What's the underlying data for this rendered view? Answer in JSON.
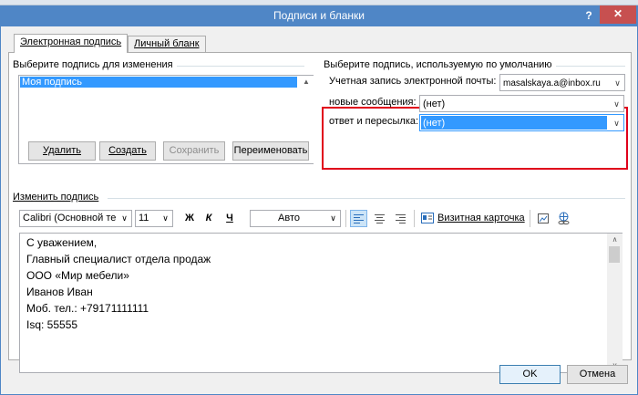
{
  "window": {
    "title": "Подписи и бланки",
    "help": "?",
    "close": "✕"
  },
  "tabs": [
    {
      "label": "Электронная подпись",
      "selected": true
    },
    {
      "label": "Личный бланк",
      "selected": false
    }
  ],
  "select_group": {
    "label": "Выберите подпись для изменения",
    "items": [
      "Моя подпись"
    ],
    "selected": "Моя подпись"
  },
  "buttons": {
    "delete": "Удалить",
    "create": "Создать",
    "save": "Сохранить",
    "rename": "Переименовать",
    "ok": "OK",
    "cancel": "Отмена"
  },
  "defaults_group": {
    "label": "Выберите подпись, используемую по умолчанию",
    "account_label": "Учетная запись электронной почты:",
    "account_value": "masalskaya.a@inbox.ru",
    "new_messages_label": "новые сообщения:",
    "new_messages_value": "(нет)",
    "replies_label": "ответ и пересылка:",
    "replies_value": "(нет)"
  },
  "edit_group": {
    "label": "Изменить подпись",
    "font_value": "Calibri (Основной те",
    "size_value": "11",
    "bold": "Ж",
    "italic": "К",
    "underline": "Ч",
    "color_value": "Авто",
    "business_card": "Визитная карточка"
  },
  "signature_lines": [
    "С уважением,",
    "Главный специалист отдела продаж",
    "ООО «Мир мебели»",
    "Иванов Иван",
    "Моб. тел.: +79171111111",
    "Isq: 55555"
  ],
  "colors": {
    "titlebar": "#4f86c6",
    "close": "#c75050",
    "highlight": "#3399ff",
    "annotation": "#e0001b"
  }
}
